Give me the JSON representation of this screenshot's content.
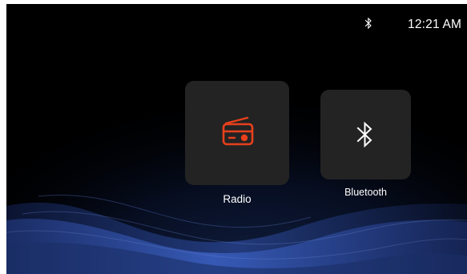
{
  "status_bar": {
    "bluetooth_icon": "bluetooth-icon",
    "time": "12:21 AM"
  },
  "apps": [
    {
      "label": "Radio",
      "icon": "radio-icon",
      "accent": "#e8401c"
    },
    {
      "label": "Bluetooth",
      "icon": "bluetooth-icon",
      "accent": "#ffffff"
    }
  ],
  "colors": {
    "background": "#000000",
    "tile": "#232323",
    "wave": "#2c4fa8",
    "text": "#ffffff"
  }
}
